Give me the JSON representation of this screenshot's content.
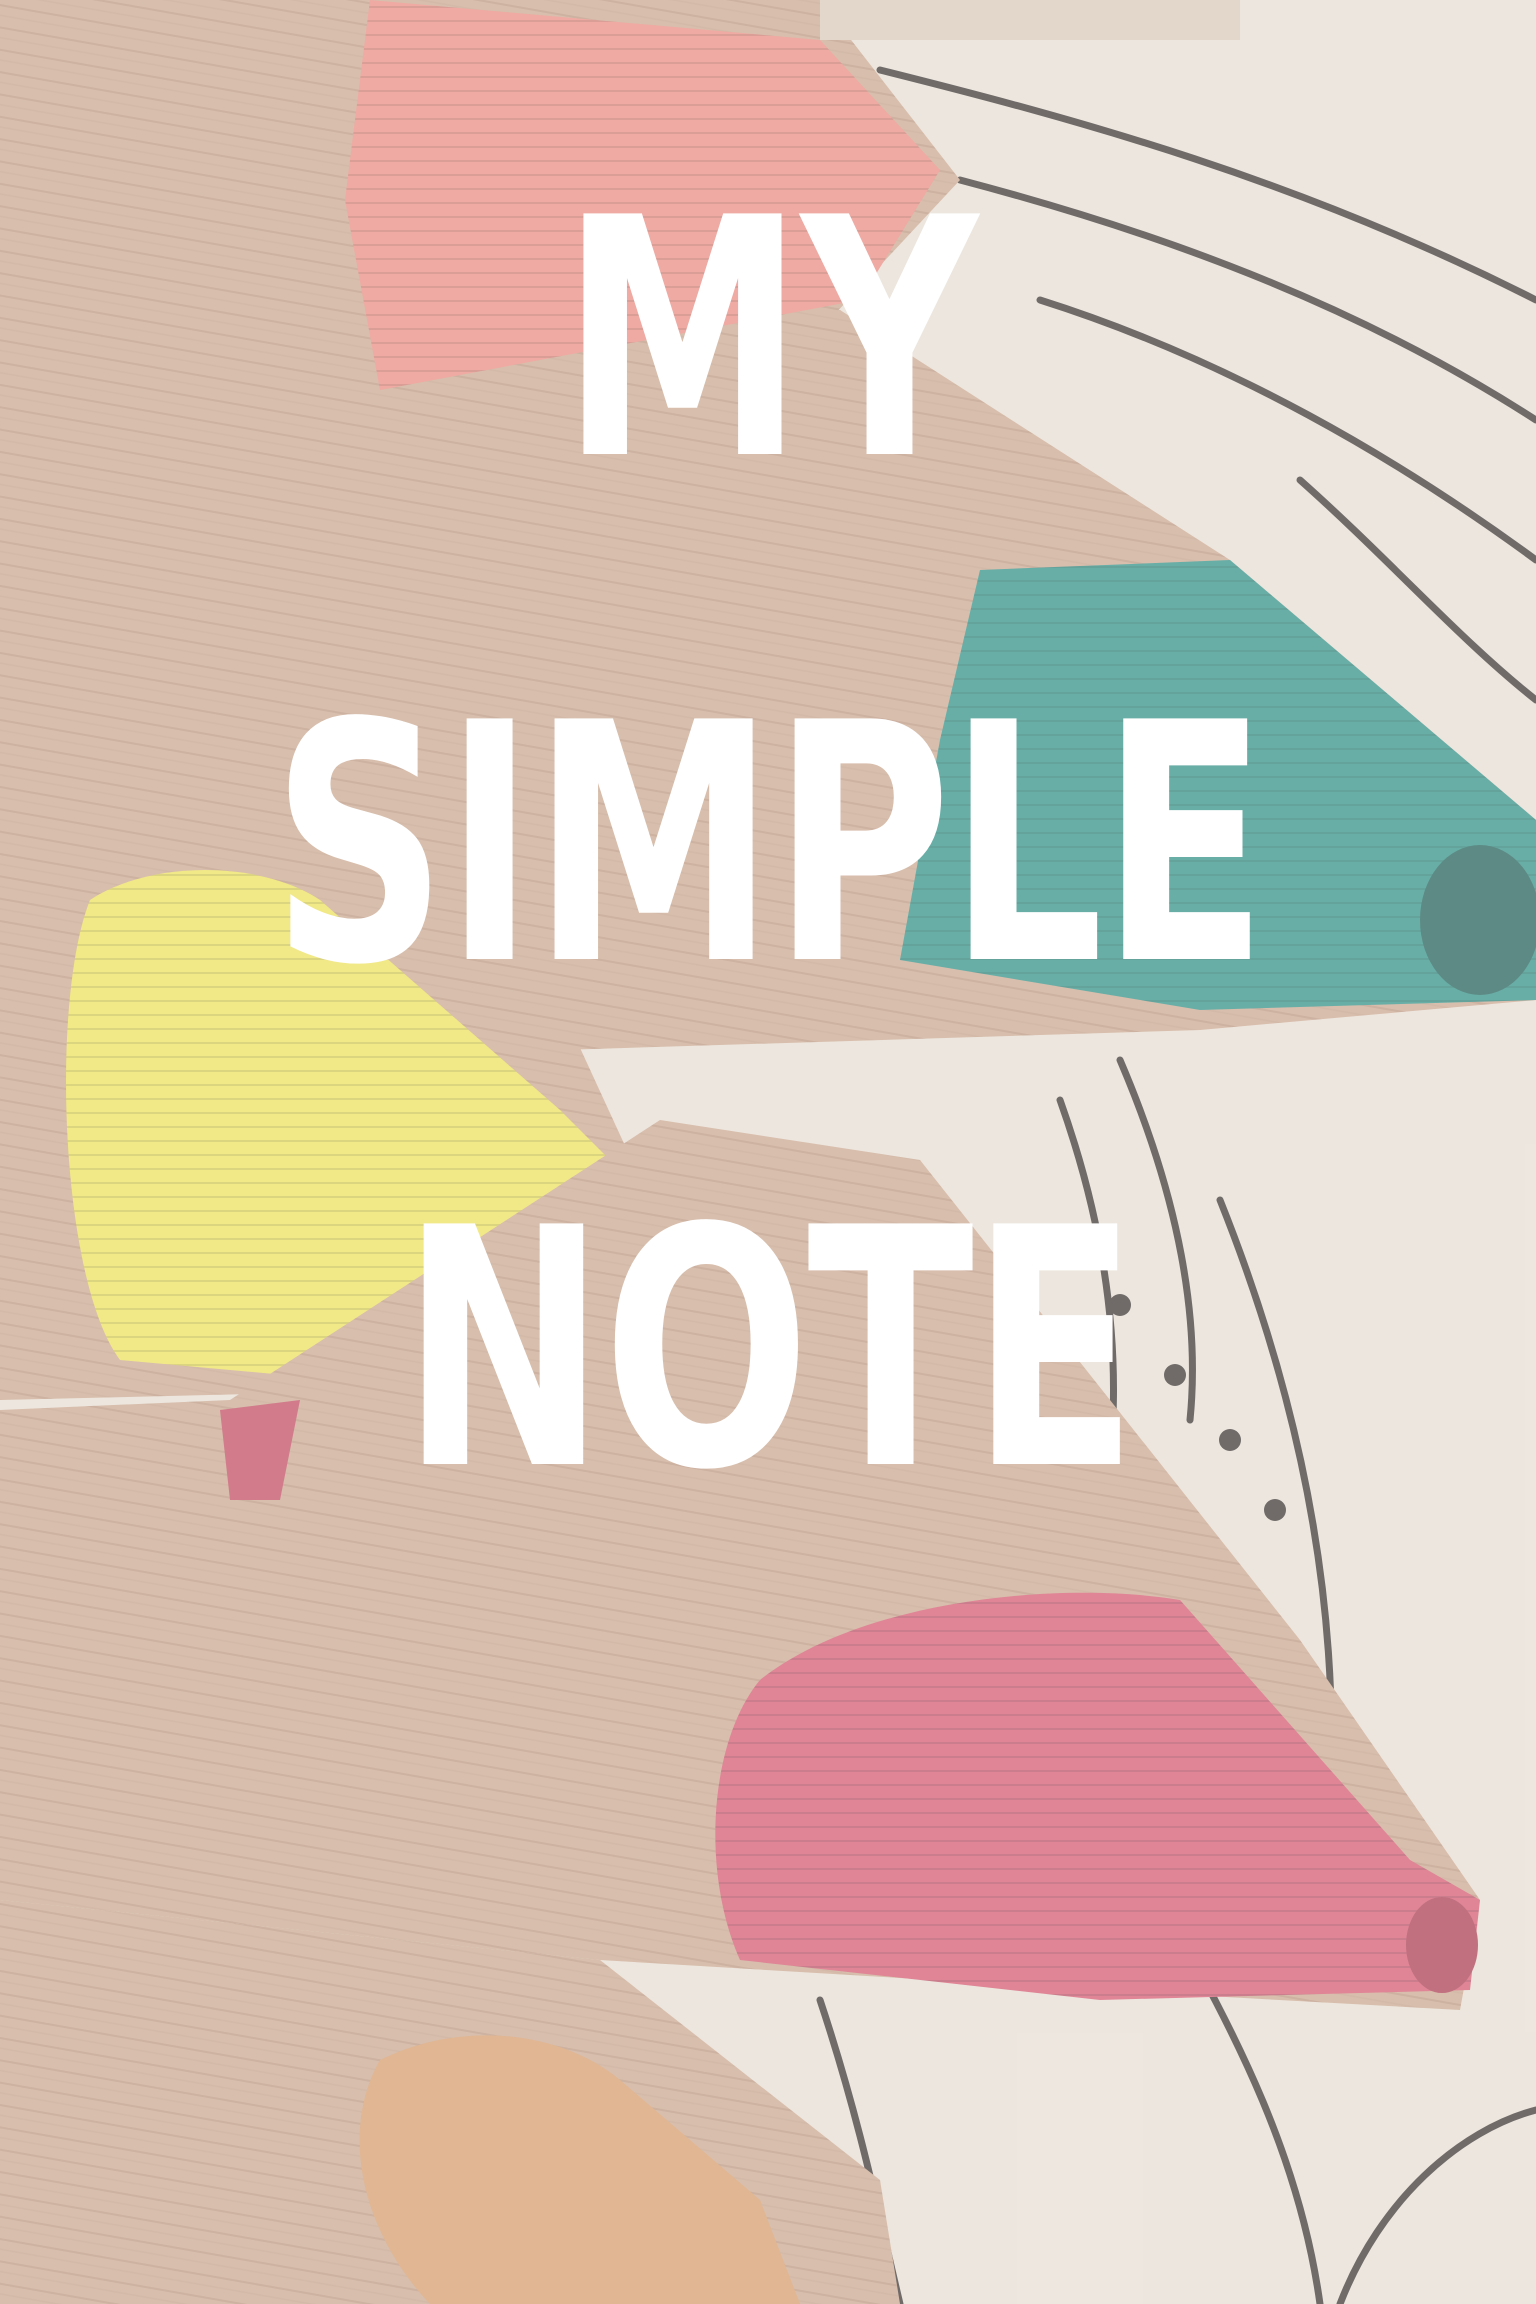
{
  "cover": {
    "title_lines": [
      "MY",
      "SIMPLE",
      "NOTE"
    ]
  },
  "photo": {
    "colors": {
      "background": "#e9e1d9",
      "paper": "#e6ddd2",
      "wood": "#c9a58c",
      "wood_dark": "#a27d64",
      "salmon_lead": "#e88a80",
      "teal_lead": "#2f8f86",
      "yellow_lead": "#ece05a",
      "crimson_lead": "#d3576e",
      "ink": "#3a3330",
      "title": "#ffffff"
    }
  }
}
